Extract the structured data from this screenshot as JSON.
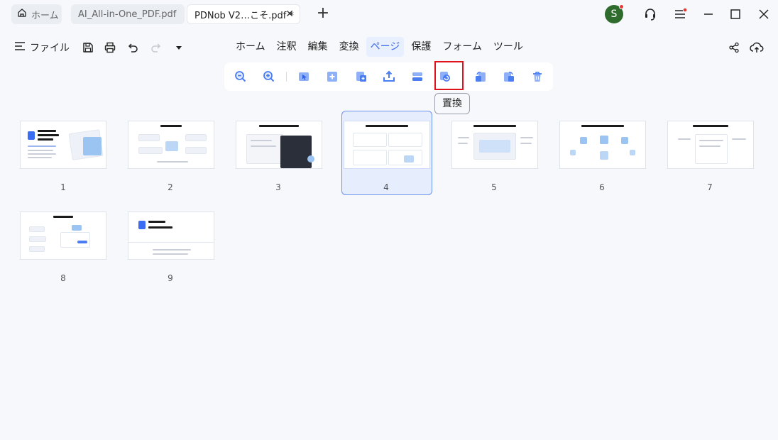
{
  "titlebar": {
    "tabs": [
      {
        "label": "ホーム",
        "icon": "home-icon"
      },
      {
        "label": "AI_All-in-One_PDF.pdf"
      },
      {
        "label": "PDNob V2…こそ.pdf *",
        "close": "✕"
      }
    ],
    "new_tab": "+",
    "avatar_letter": "S"
  },
  "menubar": {
    "file_label": "ファイル",
    "menus": [
      "ホーム",
      "注釈",
      "編集",
      "変換",
      "ページ",
      "保護",
      "フォーム",
      "ツール"
    ],
    "active_menu": "ページ"
  },
  "toolbar": {
    "tooltip": "置換",
    "tools": [
      "zoom-out-icon",
      "zoom-in-icon",
      "select-icon",
      "insert-page-icon",
      "extract-icon",
      "export-icon",
      "split-icon",
      "replace-icon",
      "rotate-left-icon",
      "rotate-right-icon",
      "delete-icon"
    ]
  },
  "pages": {
    "selected": 4,
    "numbers": [
      "1",
      "2",
      "3",
      "4",
      "5",
      "6",
      "7",
      "8",
      "9"
    ]
  },
  "colors": {
    "accent": "#3b6cf0",
    "highlight_box": "#e0121b",
    "avatar_bg": "#2e6b2c"
  }
}
